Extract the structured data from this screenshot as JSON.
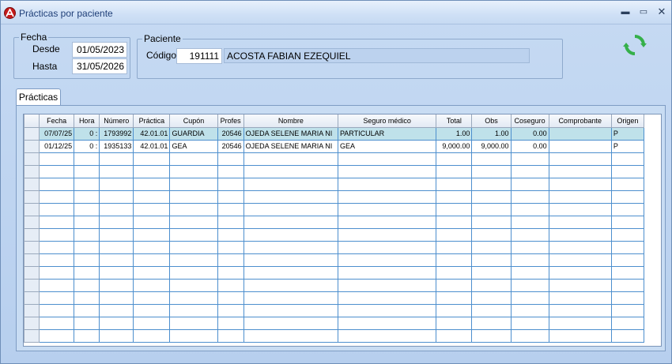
{
  "window": {
    "title": "Prácticas por paciente",
    "controls": {
      "minimize": "▬",
      "maximize": "▭",
      "close": "✕"
    }
  },
  "fecha": {
    "legend": "Fecha",
    "desde_label": "Desde",
    "desde_value": "01/05/2023",
    "hasta_label": "Hasta",
    "hasta_value": "31/05/2026"
  },
  "paciente": {
    "legend": "Paciente",
    "codigo_label": "Código",
    "codigo_value": "191111",
    "nombre_value": "ACOSTA FABIAN EZEQUIEL"
  },
  "refresh": {
    "icon": "refresh-icon",
    "color": "#35b04a"
  },
  "tabs": [
    {
      "label": "Prácticas"
    }
  ],
  "grid": {
    "columns": [
      "Fecha",
      "Hora",
      "Número",
      "Práctica",
      "Cupón",
      "Profes",
      "Nombre",
      "Seguro médico",
      "Total",
      "Obs",
      "Coseguro",
      "Comprobante",
      "Origen"
    ],
    "rows": [
      [
        "07/07/25",
        "0 :",
        "1793992",
        "42.01.01",
        "GUARDIA",
        "20546",
        "OJEDA SELENE MARIA NI",
        "PARTICULAR",
        "1.00",
        "1.00",
        "0.00",
        "",
        "P"
      ],
      [
        "01/12/25",
        "0 :",
        "1935133",
        "42.01.01",
        "GEA",
        "20546",
        "OJEDA SELENE MARIA NI",
        "GEA",
        "9,000.00",
        "9,000.00",
        "0.00",
        "",
        "P"
      ]
    ],
    "active_row": 0,
    "highlight_color": "#bfe1ea"
  }
}
